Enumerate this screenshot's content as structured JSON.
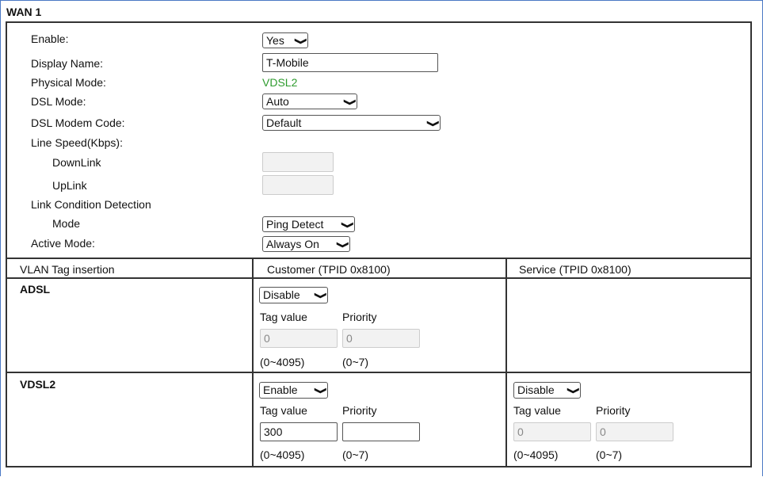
{
  "title": "WAN 1",
  "fields": {
    "enable": {
      "label": "Enable:",
      "value": "Yes"
    },
    "display_name": {
      "label": "Display Name:",
      "value": "T-Mobile"
    },
    "physical_mode": {
      "label": "Physical Mode:",
      "value": "VDSL2"
    },
    "dsl_mode": {
      "label": "DSL Mode:",
      "value": "Auto"
    },
    "dsl_modem_code": {
      "label": "DSL Modem Code:",
      "value": "Default"
    },
    "line_speed": {
      "label": "Line Speed(Kbps):",
      "downlink_label": "DownLink",
      "uplink_label": "UpLink",
      "downlink_value": "",
      "uplink_value": ""
    },
    "link_detection": {
      "label": "Link Condition Detection",
      "mode_label": "Mode",
      "mode_value": "Ping Detect"
    },
    "active_mode": {
      "label": "Active Mode:",
      "value": "Always On"
    }
  },
  "vlan": {
    "headers": [
      "VLAN Tag insertion",
      "Customer (TPID 0x8100)",
      "Service (TPID 0x8100)"
    ],
    "tag_value_label": "Tag value",
    "priority_label": "Priority",
    "tag_range": "(0~4095)",
    "priority_range": "(0~7)",
    "adsl": {
      "label": "ADSL",
      "customer": {
        "state": "Disable",
        "tag": "0",
        "priority": "0"
      }
    },
    "vdsl2": {
      "label": "VDSL2",
      "customer": {
        "state": "Enable",
        "tag": "300",
        "priority": ""
      },
      "service": {
        "state": "Disable",
        "tag": "0",
        "priority": "0"
      }
    }
  },
  "colors": {
    "accent_green": "#2e9b2e",
    "frame_blue": "#4a78c4"
  }
}
